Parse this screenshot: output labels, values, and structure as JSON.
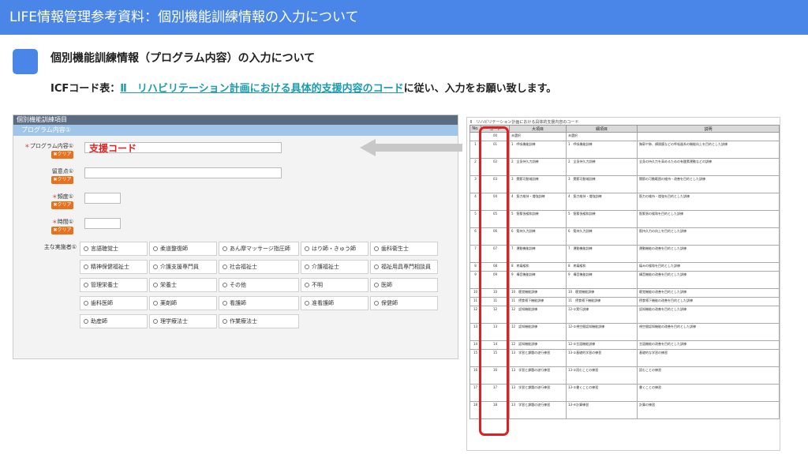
{
  "header": {
    "title": "LIFE情報管理参考資料：個別機能訓練情報の入力について"
  },
  "section": {
    "subtitle": "個別機能訓練情報（プログラム内容）の入力について",
    "icf_prefix": "ICFコード表：",
    "icf_link": "Ⅱ　リハビリテーション計画における具体的支援内容のコード",
    "icf_suffix": "に従い、入力をお願い致します。"
  },
  "form": {
    "title": "個別機能訓練項目",
    "section": "プログラム内容①",
    "fields": [
      {
        "label": "プログラム内容①",
        "required": "＊"
      },
      {
        "label": "留意点①",
        "required": ""
      },
      {
        "label": "頻度①",
        "required": "＊"
      },
      {
        "label": "時間①",
        "required": "＊"
      }
    ],
    "clear_label": "✖クリア",
    "shien_label": "支援コード",
    "jobs_label": "主な実施者①",
    "jobs": [
      "言語聴覚士",
      "柔道整復師",
      "あん摩マッサージ指圧師",
      "はり師・きゅう師",
      "歯科衛生士",
      "精神保健福祉士",
      "介護支援専門員",
      "社会福祉士",
      "介護福祉士",
      "福祉用具専門相談員",
      "管理栄養士",
      "栄養士",
      "その他",
      "不明",
      "医師",
      "歯科医師",
      "薬剤師",
      "看護師",
      "准看護師",
      "保健師",
      "助産師",
      "理学療法士",
      "作業療法士"
    ]
  },
  "table": {
    "caption": "Ⅱ　リハビリテーション計画における具体的支援内容のコード",
    "headers": [
      "No.",
      "コード",
      "大項目",
      "細項目",
      "説明"
    ],
    "rows": [
      {
        "no": "",
        "code": "00",
        "major": "未選択",
        "minor": "未選択",
        "desc": ""
      },
      {
        "no": "1",
        "code": "01",
        "major": "1　呼吸機能訓練",
        "minor": "1　呼吸機能訓練",
        "desc": "胸郭や肺、横隔膜などの呼吸器系の機能向上を目的とした訓練"
      },
      {
        "no": "2",
        "code": "02",
        "major": "2　全身持久力訓練",
        "minor": "2　全身持久力訓練",
        "desc": "全身の持久力を高めるための有酸素運動などの訓練"
      },
      {
        "no": "3",
        "code": "03",
        "major": "3　関節可動域訓練",
        "minor": "3　関節可動域訓練",
        "desc": "関節の可動範囲の維持・改善を目的とした訓練"
      },
      {
        "no": "4",
        "code": "04",
        "major": "4　筋力維持・増強訓練",
        "minor": "4　筋力維持・増強訓練",
        "desc": "筋力の維持・増強を目的とした訓練"
      },
      {
        "no": "5",
        "code": "05",
        "major": "5　筋緊張緩和訓練",
        "minor": "5　筋緊張緩和訓練",
        "desc": "筋緊張の緩和を目的とした訓練"
      },
      {
        "no": "6",
        "code": "06",
        "major": "6　筋持久力訓練",
        "minor": "6　筋持久力訓練",
        "desc": "筋持久力の向上を目的とした訓練"
      },
      {
        "no": "7",
        "code": "07",
        "major": "7　運動機能訓練",
        "minor": "7　運動機能訓練",
        "desc": "運動機能の改善を目的とした訓練"
      },
      {
        "no": "8",
        "code": "08",
        "major": "8　疼痛緩和",
        "minor": "8　疼痛緩和",
        "desc": "痛みの緩和を目的とした訓練"
      },
      {
        "no": "9",
        "code": "09",
        "major": "9　構音機能訓練",
        "minor": "9　構音機能訓練",
        "desc": "構音機能の改善を目的とした訓練"
      },
      {
        "no": "10",
        "code": "10",
        "major": "10　聴覚機能訓練",
        "minor": "10　聴覚機能訓練",
        "desc": "聴覚機能の改善を目的とした訓練"
      },
      {
        "no": "11",
        "code": "11",
        "major": "11　摂食嚥下機能訓練",
        "minor": "11　摂食嚥下機能訓練",
        "desc": "摂食嚥下機能の改善を目的とした訓練"
      },
      {
        "no": "12",
        "code": "12",
        "major": "12　認知機能訓練",
        "minor": "12-①実行訓練",
        "desc": "認知機能の改善を目的とした訓練"
      },
      {
        "no": "13",
        "code": "13",
        "major": "12　認知機能訓練",
        "minor": "12-②視空間認知機能訓練",
        "desc": "視空間認知機能の改善を目的とした訓練"
      },
      {
        "no": "14",
        "code": "14",
        "major": "12　認知機能訓練",
        "minor": "12-③言語機能訓練",
        "desc": "言語機能の改善を目的とした訓練"
      },
      {
        "no": "15",
        "code": "15",
        "major": "13　学習と課題の遂行練習",
        "minor": "13-①基礎的学習の練習",
        "desc": "基礎的な学習の練習"
      },
      {
        "no": "16",
        "code": "16",
        "major": "13　学習と課題の遂行練習",
        "minor": "13-②読むことの練習",
        "desc": "読むことの練習"
      },
      {
        "no": "17",
        "code": "17",
        "major": "13　学習と課題の遂行練習",
        "minor": "13-③書くことの練習",
        "desc": "書くことの練習"
      },
      {
        "no": "18",
        "code": "18",
        "major": "13　学習と課題の遂行練習",
        "minor": "13-④計算練習",
        "desc": "計算の練習"
      }
    ]
  }
}
